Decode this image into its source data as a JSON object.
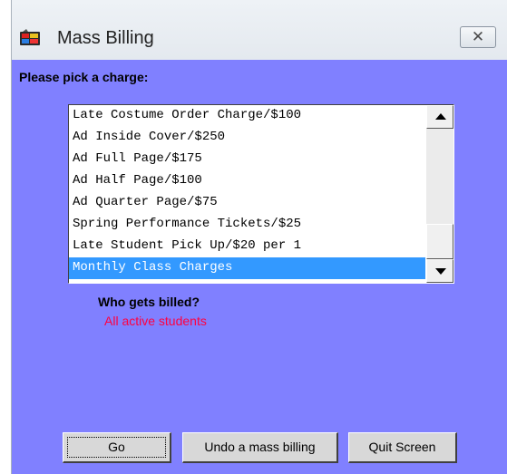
{
  "window": {
    "title": "Mass Billing",
    "app_icon": "film-strip-icon",
    "close_glyph": "✕"
  },
  "charge_picker": {
    "prompt": "Please pick a charge:",
    "items": [
      "Late Costume Order Charge/$100",
      "Ad Inside Cover/$250",
      "Ad Full Page/$175",
      "Ad Half Page/$100",
      "Ad Quarter Page/$75",
      "Spring Performance Tickets/$25",
      "Late Student Pick Up/$20 per 1",
      "Monthly Class Charges"
    ],
    "selected_index": 7
  },
  "billing": {
    "question": "Who gets billed?",
    "answer": "All active students"
  },
  "buttons": {
    "go": "Go",
    "undo": "Undo a mass billing",
    "quit": "Quit Screen"
  },
  "colors": {
    "client_bg": "#8080ff",
    "selection": "#3399ff",
    "answer_text": "#ff0040"
  }
}
